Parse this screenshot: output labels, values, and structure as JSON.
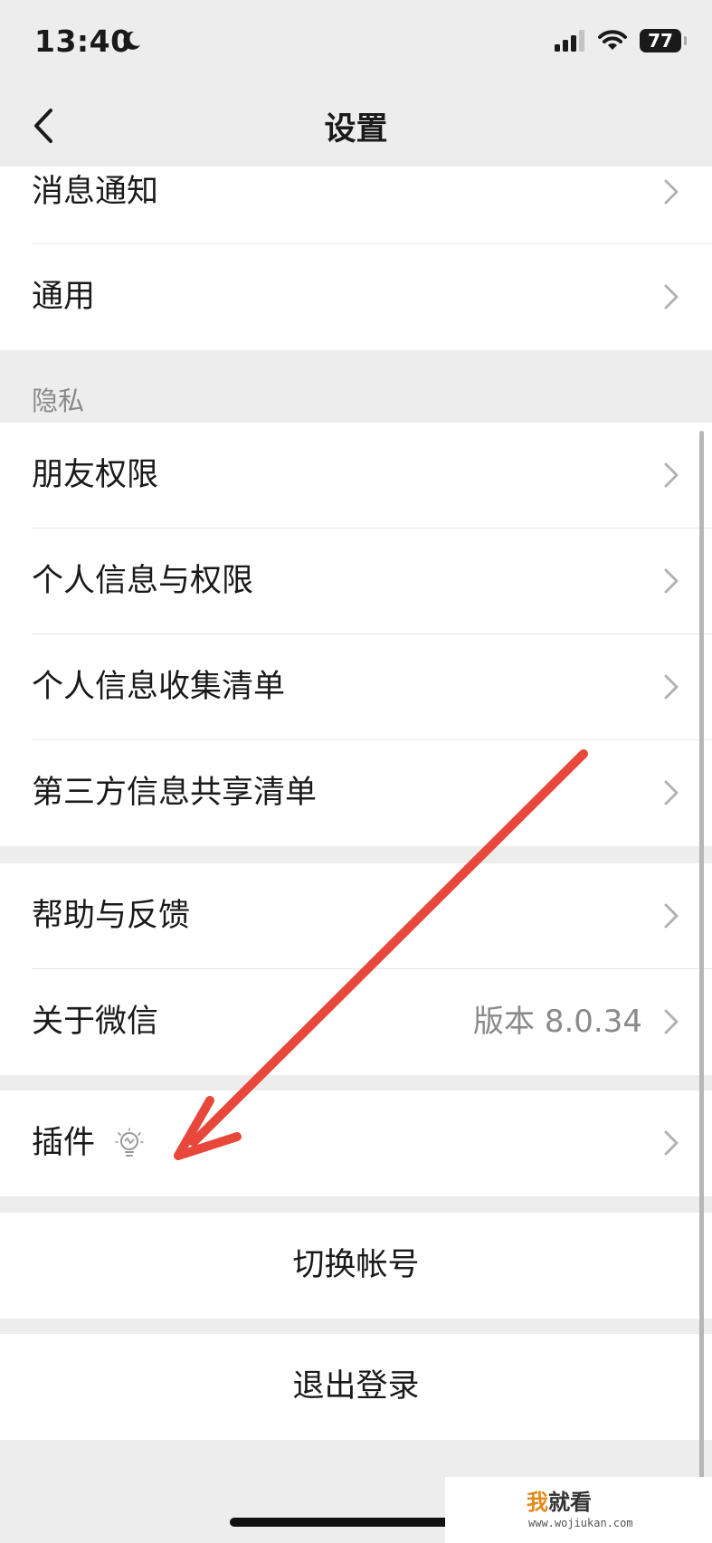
{
  "status_bar": {
    "time": "13:40",
    "battery": "77"
  },
  "nav": {
    "title": "设置"
  },
  "group_top": {
    "items": [
      {
        "label": "消息通知"
      },
      {
        "label": "通用"
      }
    ]
  },
  "privacy": {
    "header": "隐私",
    "items": [
      {
        "label": "朋友权限"
      },
      {
        "label": "个人信息与权限"
      },
      {
        "label": "个人信息收集清单"
      },
      {
        "label": "第三方信息共享清单"
      }
    ]
  },
  "support": {
    "items": [
      {
        "label": "帮助与反馈"
      },
      {
        "label": "关于微信",
        "value": "版本 8.0.34"
      }
    ]
  },
  "plugins": {
    "label": "插件"
  },
  "actions": {
    "switch_account": "切换帐号",
    "logout": "退出登录"
  },
  "watermark": {
    "brand_prefix": "我",
    "brand_suffix": "就看",
    "url": "www.wojiukan.com"
  },
  "colors": {
    "background": "#ededed",
    "annotation_arrow": "#e8473b",
    "secondary_text": "#8a8a8a"
  },
  "icons": {
    "back": "chevron-left-icon",
    "row_chevron": "chevron-right-icon",
    "plugin_badge": "lightbulb-icon",
    "moon": "moon-icon",
    "signal": "signal-icon",
    "wifi": "wifi-icon"
  }
}
